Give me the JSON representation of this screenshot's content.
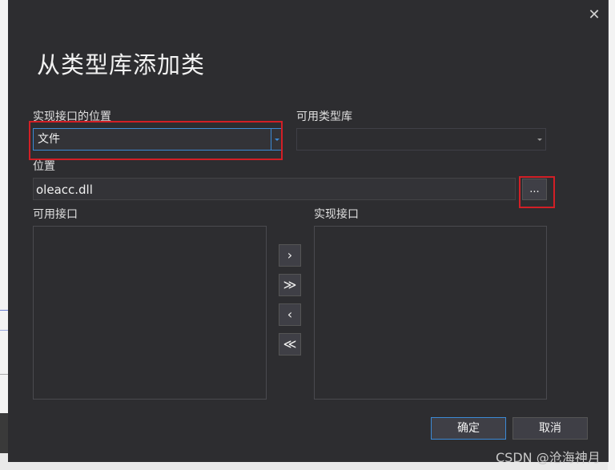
{
  "dialog": {
    "title": "从类型库添加类",
    "close_glyph": "✕"
  },
  "fields": {
    "implement_location_label": "实现接口的位置",
    "implement_location_value": "文件",
    "available_typelib_label": "可用类型库",
    "available_typelib_value": "",
    "location_label": "位置",
    "location_value": "oleacc.dll",
    "browse_label": "..."
  },
  "lists": {
    "available_interfaces_label": "可用接口",
    "implemented_interfaces_label": "实现接口"
  },
  "move_buttons": {
    "add_one": "›",
    "add_all": "≫",
    "remove_one": "‹",
    "remove_all": "≪"
  },
  "footer": {
    "ok_label": "确定",
    "cancel_label": "取消"
  },
  "watermark": "CSDN @沧海神月",
  "colors": {
    "highlight_box": "#d21f26",
    "accent": "#3c8ad6",
    "dialog_bg": "#2d2d30"
  }
}
